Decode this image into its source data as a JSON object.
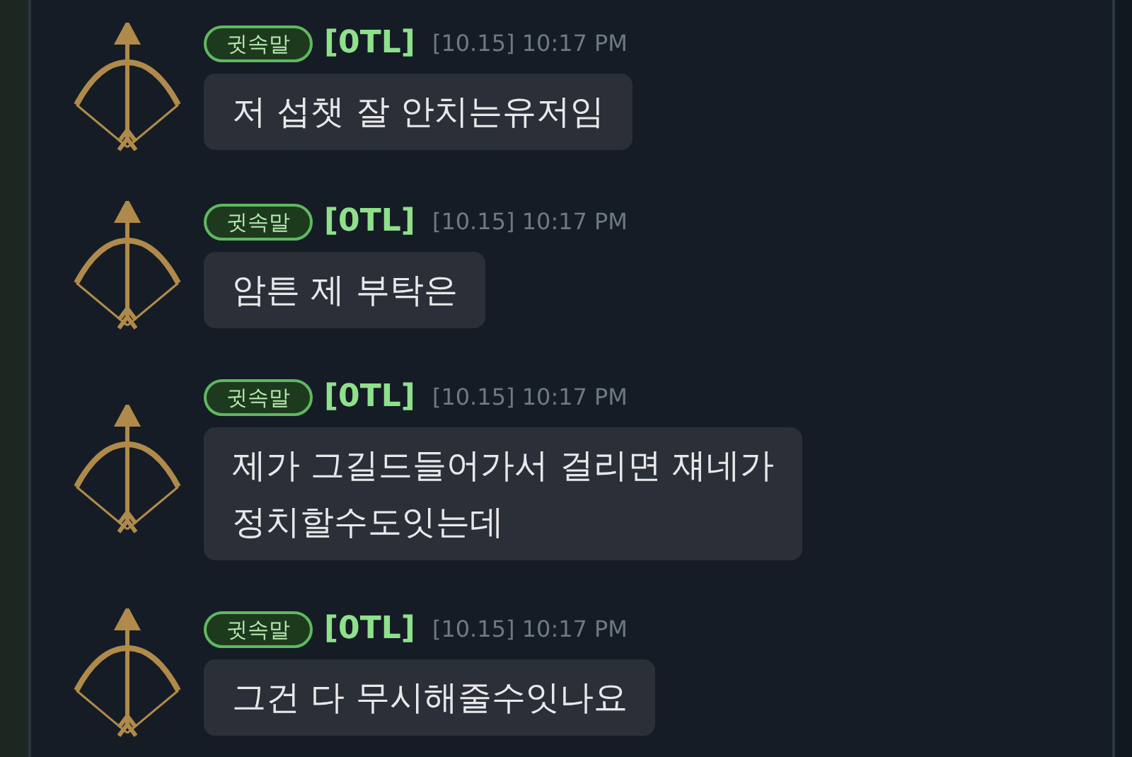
{
  "messages": [
    {
      "badge": "귓속말",
      "sender": "[0TL]",
      "time": "[10.15] 10:17 PM",
      "lines": [
        "저 섭챗 잘 안치는유저임"
      ]
    },
    {
      "badge": "귓속말",
      "sender": "[0TL]",
      "time": "[10.15] 10:17 PM",
      "lines": [
        "암튼 제 부탁은"
      ]
    },
    {
      "badge": "귓속말",
      "sender": "[0TL]",
      "time": "[10.15] 10:17 PM",
      "lines": [
        "제가 그길드들어가서 걸리면 쟤네가",
        "정치할수도잇는데"
      ]
    },
    {
      "badge": "귓속말",
      "sender": "[0TL]",
      "time": "[10.15] 10:17 PM",
      "lines": [
        "그건 다 무시해줄수잇나요"
      ]
    }
  ]
}
